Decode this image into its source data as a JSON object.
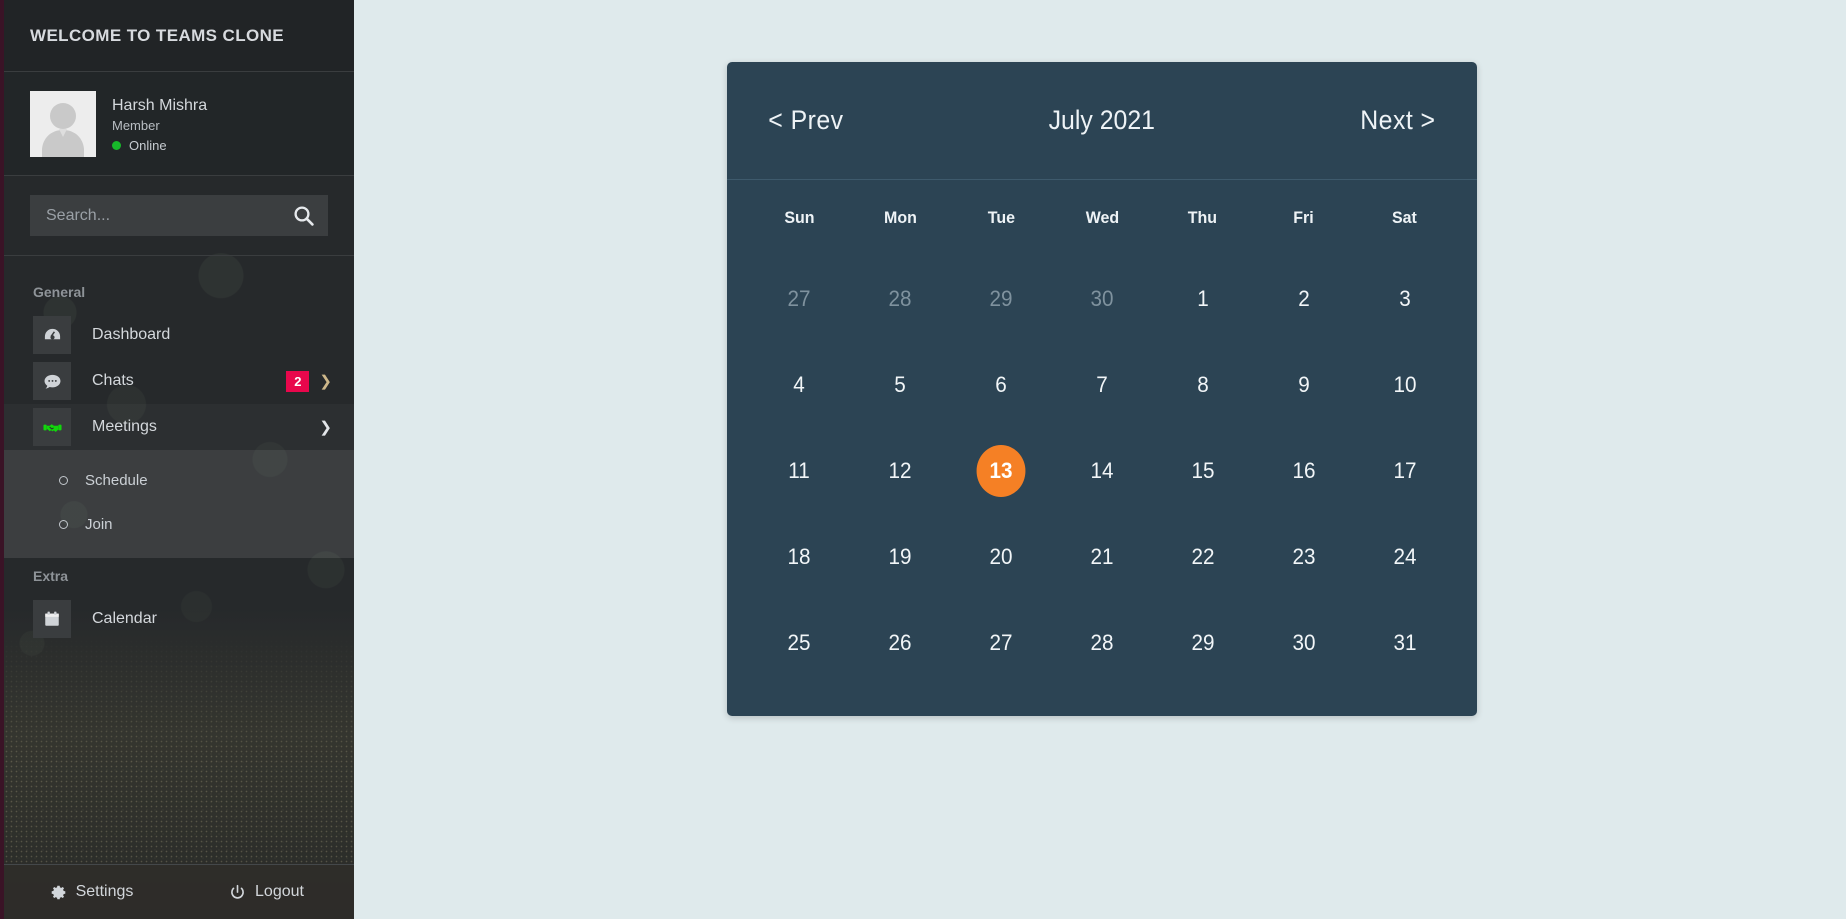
{
  "sidebar": {
    "header_title": "WELCOME TO TEAMS CLONE",
    "profile": {
      "avatar_icon": "user-placeholder-avatar",
      "name": "Harsh Mishra",
      "role": "Member",
      "status": "Online",
      "status_color": "#17b82a"
    },
    "search": {
      "placeholder": "Search...",
      "value": "",
      "icon": "search-icon"
    },
    "sections": [
      {
        "title": "General",
        "items": [
          {
            "label": "Dashboard",
            "icon": "dashboard-gauge-icon",
            "badge": null,
            "chevron": null
          },
          {
            "label": "Chats",
            "icon": "chat-bubble-icon",
            "badge": "2",
            "chevron": "chevron-right-icon"
          },
          {
            "label": "Meetings",
            "icon": "handshake-icon",
            "badge": null,
            "chevron": "chevron-down-icon",
            "submenu": [
              {
                "label": "Schedule"
              },
              {
                "label": "Join"
              }
            ]
          }
        ]
      },
      {
        "title": "Extra",
        "items": [
          {
            "label": "Calendar",
            "icon": "calendar-icon",
            "badge": null,
            "chevron": null
          }
        ]
      }
    ],
    "footer": {
      "settings_label": "Settings",
      "settings_icon": "gear-icon",
      "logout_label": "Logout",
      "logout_icon": "power-icon"
    },
    "badge_color": "#e8074c"
  },
  "calendar": {
    "prev_label": "< Prev",
    "title": "July 2021",
    "next_label": "Next >",
    "weekdays": [
      "Sun",
      "Mon",
      "Tue",
      "Wed",
      "Thu",
      "Fri",
      "Sat"
    ],
    "highlight_color": "#f58025",
    "panel_color": "#2c4454",
    "selected_day": "13",
    "weeks": [
      [
        {
          "day": "27",
          "muted": true,
          "today": false
        },
        {
          "day": "28",
          "muted": true,
          "today": false
        },
        {
          "day": "29",
          "muted": true,
          "today": false
        },
        {
          "day": "30",
          "muted": true,
          "today": false
        },
        {
          "day": "1",
          "muted": false,
          "today": false
        },
        {
          "day": "2",
          "muted": false,
          "today": false
        },
        {
          "day": "3",
          "muted": false,
          "today": false
        }
      ],
      [
        {
          "day": "4",
          "muted": false,
          "today": false
        },
        {
          "day": "5",
          "muted": false,
          "today": false
        },
        {
          "day": "6",
          "muted": false,
          "today": false
        },
        {
          "day": "7",
          "muted": false,
          "today": false
        },
        {
          "day": "8",
          "muted": false,
          "today": false
        },
        {
          "day": "9",
          "muted": false,
          "today": false
        },
        {
          "day": "10",
          "muted": false,
          "today": false
        }
      ],
      [
        {
          "day": "11",
          "muted": false,
          "today": false
        },
        {
          "day": "12",
          "muted": false,
          "today": false
        },
        {
          "day": "13",
          "muted": false,
          "today": true
        },
        {
          "day": "14",
          "muted": false,
          "today": false
        },
        {
          "day": "15",
          "muted": false,
          "today": false
        },
        {
          "day": "16",
          "muted": false,
          "today": false
        },
        {
          "day": "17",
          "muted": false,
          "today": false
        }
      ],
      [
        {
          "day": "18",
          "muted": false,
          "today": false
        },
        {
          "day": "19",
          "muted": false,
          "today": false
        },
        {
          "day": "20",
          "muted": false,
          "today": false
        },
        {
          "day": "21",
          "muted": false,
          "today": false
        },
        {
          "day": "22",
          "muted": false,
          "today": false
        },
        {
          "day": "23",
          "muted": false,
          "today": false
        },
        {
          "day": "24",
          "muted": false,
          "today": false
        }
      ],
      [
        {
          "day": "25",
          "muted": false,
          "today": false
        },
        {
          "day": "26",
          "muted": false,
          "today": false
        },
        {
          "day": "27",
          "muted": false,
          "today": false
        },
        {
          "day": "28",
          "muted": false,
          "today": false
        },
        {
          "day": "29",
          "muted": false,
          "today": false
        },
        {
          "day": "30",
          "muted": false,
          "today": false
        },
        {
          "day": "31",
          "muted": false,
          "today": false
        }
      ]
    ]
  },
  "page": {
    "background_color": "#dfeaec"
  }
}
